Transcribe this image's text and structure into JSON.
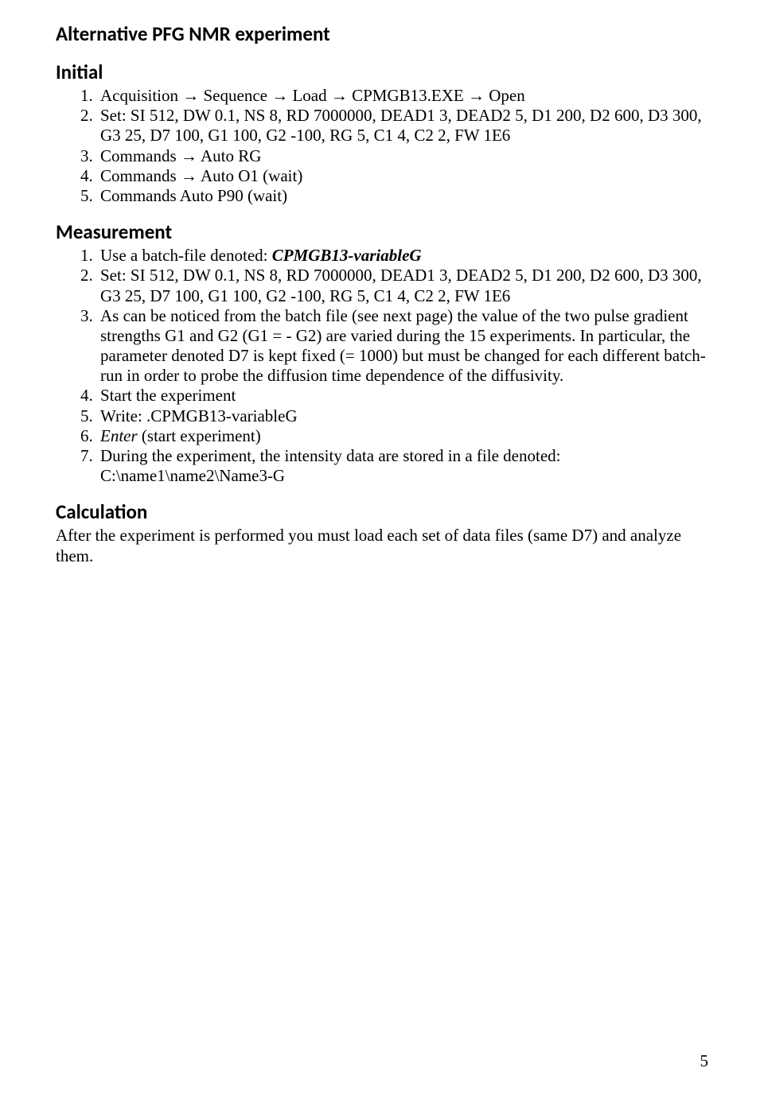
{
  "title": "Alternative PFG NMR experiment",
  "sections": {
    "initial": {
      "heading": "Initial",
      "items": [
        "Acquisition → Sequence → Load → CPMGB13.EXE → Open",
        "Set: SI 512, DW 0.1, NS 8, RD 7000000, DEAD1 3, DEAD2 5, D1 200, D2 600, D3 300, G3 25, D7 100, G1 100, G2 -100, RG 5, C1 4, C2 2, FW 1E6",
        "Commands → Auto RG",
        "Commands → Auto O1 (wait)",
        "Commands Auto P90 (wait)"
      ]
    },
    "measurement": {
      "heading": "Measurement",
      "items": {
        "i1_pre": "Use a batch-file denoted: ",
        "i1_em": "CPMGB13-variableG",
        "i2": "Set: SI 512, DW 0.1, NS 8, RD 7000000, DEAD1 3, DEAD2 5, D1 200, D2 600, D3 300, G3 25, D7 100, G1 100, G2 -100, RG 5, C1 4, C2 2, FW 1E6",
        "i3": "As can be noticed from the batch file (see next page) the value of the two pulse gradient strengths G1 and G2 (G1 = - G2) are varied during the 15 experiments. In particular, the parameter denoted D7 is kept fixed (= 1000) but must be changed for each different batch-run in order to probe the diffusion time dependence of the diffusivity.",
        "i4": "Start the experiment",
        "i5": "Write: .CPMGB13-variableG",
        "i6_em": "Enter",
        "i6_post": " (start experiment)",
        "i7": "During the experiment, the intensity data are stored in a file denoted: C:\\name1\\name2\\Name3-G"
      }
    },
    "calculation": {
      "heading": "Calculation",
      "body": "After the experiment is performed you must load each set of data files (same D7) and analyze them."
    }
  },
  "page_number": "5"
}
